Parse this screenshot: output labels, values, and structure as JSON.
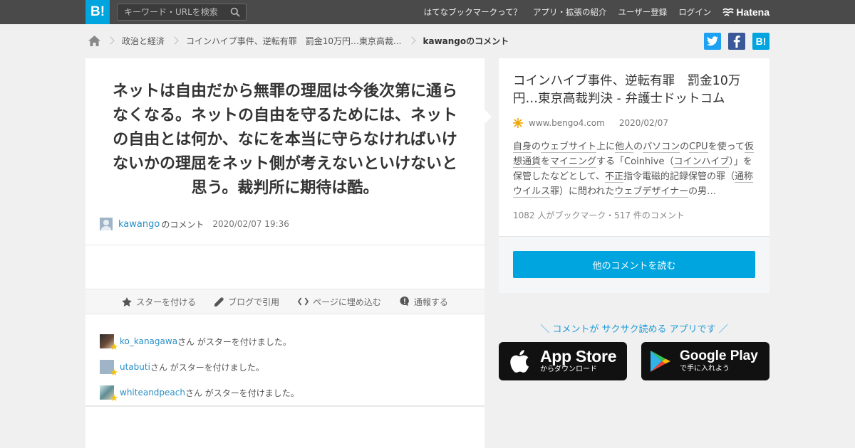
{
  "header": {
    "logo": "B!",
    "search_placeholder": "キーワード・URLを検索",
    "nav": [
      "はてなブックマークって？",
      "アプリ・拡張の紹介",
      "ユーザー登録",
      "ログイン"
    ],
    "brand": "Hatena"
  },
  "breadcrumb": {
    "items": [
      "政治と経済",
      "コインハイブ事件、逆転有罪　罰金10万円…東京高裁..."
    ],
    "current": "kawangoのコメント"
  },
  "share": {
    "hatena_label": "B!"
  },
  "comment": {
    "text": "ネットは自由だから無罪の理屈は今後次第に通らなくなる。ネットの自由を守るためには、ネットの自由とは何か、なにを本当に守らなければいけないかの理屈をネット側が考えないといけないと思う。裁判所に期待は酷。",
    "user": "kawango",
    "suffix": "のコメント",
    "datetime": "2020/02/07 19:36"
  },
  "actions": {
    "star": "スターを付ける",
    "blog": "ブログで引用",
    "embed": "ページに埋め込む",
    "report": "通報する"
  },
  "stars": [
    {
      "user": "ko_kanagawa",
      "text": "さん がスターを付けました。"
    },
    {
      "user": "utabuti",
      "text": "さん がスターを付けました。"
    },
    {
      "user": "whiteandpeach",
      "text": "さん がスターを付けました。"
    }
  ],
  "entry": {
    "title": "コインハイブ事件、逆転有罪　罰金10万円…東京高裁判決 - 弁護士ドットコム",
    "domain": "www.bengo4.com",
    "date": "2020/02/07",
    "desc_parts": [
      {
        "t": "自身",
        "k": true
      },
      {
        "t": "の",
        "k": false
      },
      {
        "t": "ウェブサイト",
        "k": true
      },
      {
        "t": "上に",
        "k": false
      },
      {
        "t": "他人",
        "k": true
      },
      {
        "t": "の",
        "k": false
      },
      {
        "t": "パソコン",
        "k": true
      },
      {
        "t": "の",
        "k": false
      },
      {
        "t": "CPU",
        "k": true
      },
      {
        "t": "を使って",
        "k": false
      },
      {
        "t": "仮想通貨",
        "k": true
      },
      {
        "t": "を",
        "k": false
      },
      {
        "t": "マイニング",
        "k": true
      },
      {
        "t": "する「Coinhive（",
        "k": false
      },
      {
        "t": "コインハイブ",
        "k": true
      },
      {
        "t": "）」を保管したなどとして、",
        "k": false
      },
      {
        "t": "不正",
        "k": true
      },
      {
        "t": "指令電磁的記録保管の罪（",
        "k": false
      },
      {
        "t": "通称",
        "k": true
      },
      {
        "t": "ウイルス",
        "k": true
      },
      {
        "t": "罪）に問われた",
        "k": false
      },
      {
        "t": "ウェブデザイナー",
        "k": true
      },
      {
        "t": "の男…",
        "k": false
      }
    ],
    "count": "1082 人がブックマーク・517 件のコメント",
    "read_button": "他のコメントを読む"
  },
  "promo": {
    "text": "＼ コメントが サクサク読める アプリです ／",
    "appstore_big": "App Store",
    "appstore_small": "からダウンロード",
    "gplay_big": "Google Play",
    "gplay_small": "で手に入れよう"
  },
  "colors": {
    "hatena_blue": "#00a4de",
    "header_bg": "#4a4a4a",
    "twitter": "#1da1f2",
    "facebook": "#3b5998",
    "link": "#2a8fc7"
  }
}
